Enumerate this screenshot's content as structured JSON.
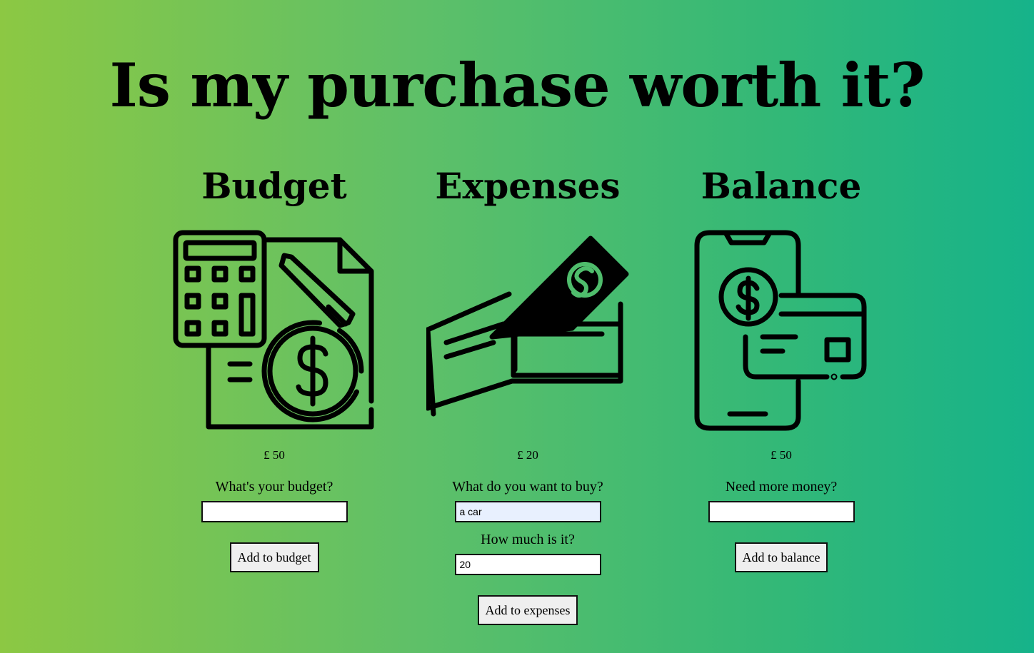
{
  "page": {
    "title": "Is my purchase worth it?"
  },
  "budget": {
    "heading": "Budget",
    "icon": "calculator-document-dollar-icon",
    "amount": "£ 50",
    "prompt": "What's your budget?",
    "input_value": "",
    "button_label": "Add to budget"
  },
  "expenses": {
    "heading": "Expenses",
    "icon": "wallet-cash-icon",
    "amount": "£ 20",
    "item_prompt": "What do you want to buy?",
    "item_value": "a car",
    "cost_prompt": "How much is it?",
    "cost_value": "20",
    "button_label": "Add to expenses"
  },
  "balance": {
    "heading": "Balance",
    "icon": "phone-card-payment-icon",
    "amount": "£ 50",
    "prompt": "Need more money?",
    "input_value": "",
    "button_label": "Add to balance"
  },
  "colors": {
    "gradient_start": "#8cc843",
    "gradient_end": "#16b38a",
    "input_autofill": "#e8f0fe",
    "button_bg": "#efefef"
  }
}
